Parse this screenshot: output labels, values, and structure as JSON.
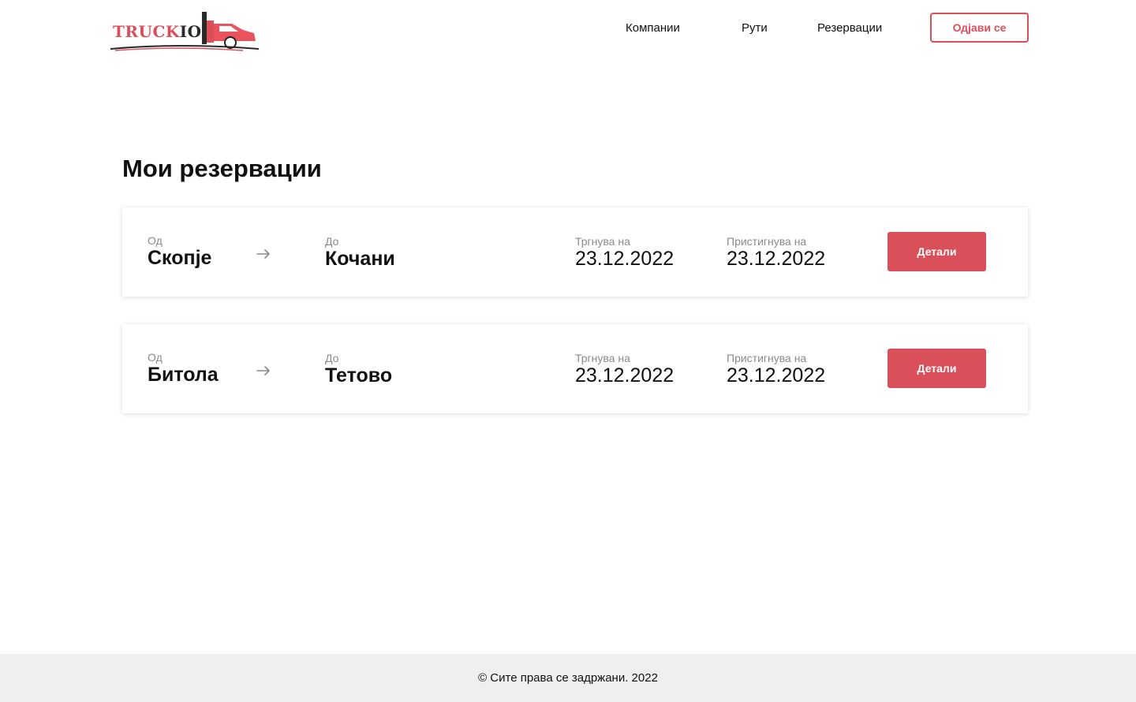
{
  "header": {
    "logo": {
      "text_a": "TRUCK",
      "text_b": "IO",
      "icon": "truck-icon"
    },
    "nav": {
      "companies": "Компании",
      "routes": "Рути",
      "reservations": "Резервации"
    },
    "logout_label": "Одјави се"
  },
  "main": {
    "title": "Мои резервации",
    "reservations": [
      {
        "from_label": "Од",
        "from": "Скопје",
        "to_label": "До",
        "to": "Кочани",
        "departure_label": "Тргнува на",
        "departure": "23.12.2022",
        "arrival_label": "Пристигнува на",
        "arrival": "23.12.2022",
        "details_label": "Детали"
      },
      {
        "from_label": "Од",
        "from": "Битола",
        "to_label": "До",
        "to": "Тетово",
        "departure_label": "Тргнува на",
        "departure": "23.12.2022",
        "arrival_label": "Пристигнува на",
        "arrival": "23.12.2022",
        "details_label": "Детали"
      }
    ]
  },
  "footer": {
    "text": "© Сите права се задржани. 2022"
  },
  "colors": {
    "accent": "#d9505a",
    "footer_bg": "#efefef",
    "muted": "#8a8a8a"
  }
}
